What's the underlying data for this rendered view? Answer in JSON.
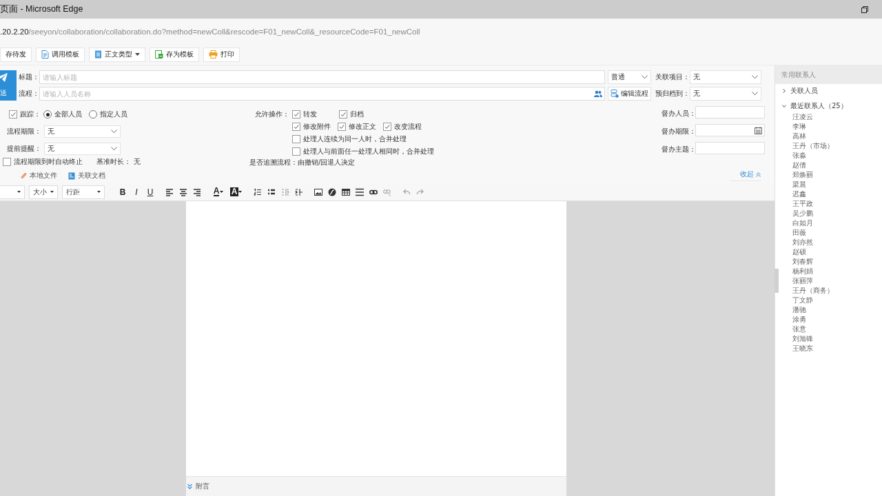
{
  "window": {
    "title": "页面 - Microsoft Edge"
  },
  "address": {
    "host": ".20.2.20",
    "path": "/seeyon/collaboration/collaboration.do?method=newColl&rescode=F01_newColl&_resourceCode=F01_newColl"
  },
  "toolbar": [
    {
      "label": "存待发",
      "has_menu": false
    },
    {
      "label": "调用模板",
      "has_menu": false
    },
    {
      "label": "正文类型",
      "has_menu": true
    },
    {
      "label": "存为模板",
      "has_menu": false
    },
    {
      "label": "打印",
      "has_menu": false
    }
  ],
  "send": {
    "label": "送"
  },
  "subject": {
    "label": "标题：",
    "placeholder": "请输入标题",
    "importance": "普通"
  },
  "flow": {
    "label": "流程：",
    "placeholder": "请输入人员名称",
    "edit_button": "编辑流程"
  },
  "related_project": {
    "label": "关联项目：",
    "value": "无"
  },
  "archive": {
    "label": "预归档到：",
    "value": "无"
  },
  "track": {
    "label": "跟踪：",
    "checked": true,
    "options": [
      {
        "label": "全部人员",
        "selected": true
      },
      {
        "label": "指定人员",
        "selected": false
      }
    ]
  },
  "deadline": {
    "label": "流程期限：",
    "value": "无"
  },
  "reminder": {
    "label": "提前提醒：",
    "value": "无"
  },
  "auto_end": {
    "label": "流程期限到时自动终止",
    "checked": false
  },
  "base_duration": {
    "label": "基准时长：",
    "value": "无"
  },
  "attachments": [
    {
      "label": "本地文件"
    },
    {
      "label": "关联文档"
    }
  ],
  "permissions": {
    "label": "允许操作：",
    "rows": [
      {
        "items": [
          {
            "label": "转发",
            "checked": true
          },
          {
            "label": "归档",
            "checked": true
          }
        ]
      },
      {
        "items": [
          {
            "label": "修改附件",
            "checked": true
          },
          {
            "label": "修改正文",
            "checked": true
          },
          {
            "label": "改变流程",
            "checked": true
          }
        ]
      },
      {
        "items": [
          {
            "label": "处理人连续为同一人时，合并处理",
            "checked": false
          }
        ]
      },
      {
        "items": [
          {
            "label": "处理人与前面任一处理人相同时，合并处理",
            "checked": false
          }
        ]
      }
    ]
  },
  "trace": {
    "label": "是否追溯流程：",
    "value": "由撤销/回退人决定"
  },
  "supervision": [
    {
      "label": "督办人员：",
      "kind": "text"
    },
    {
      "label": "督办期限：",
      "kind": "date"
    },
    {
      "label": "督办主题：",
      "kind": "text"
    }
  ],
  "collapse": "收起",
  "editor_toolbar": {
    "selects": [
      {
        "label": "大小"
      },
      {
        "label": "行距"
      }
    ],
    "format_buttons": [
      {
        "label": "B"
      },
      {
        "label": "I"
      },
      {
        "label": "U"
      }
    ],
    "tool_buttons": [
      {
        "disabled": false
      },
      {
        "disabled": false
      },
      {
        "disabled": false
      },
      {
        "label": "A",
        "disabled": false
      },
      {
        "label": "A",
        "disabled": false
      },
      {
        "disabled": false
      },
      {
        "disabled": false
      },
      {
        "disabled": true
      },
      {
        "disabled": false
      },
      {
        "disabled": false
      },
      {
        "disabled": false
      },
      {
        "disabled": false
      },
      {
        "disabled": false
      },
      {
        "disabled": false
      },
      {
        "disabled": true
      },
      {
        "disabled": true
      },
      {
        "disabled": true
      }
    ]
  },
  "footer": {
    "label": "附言"
  },
  "sidebar": {
    "title": "常用联系人",
    "groups": [
      {
        "label": "关联人员",
        "expanded": false
      },
      {
        "label": "最近联系人（25）",
        "expanded": true,
        "children": [
          {
            "label": "汪凌云"
          },
          {
            "label": "李琳"
          },
          {
            "label": "高林"
          },
          {
            "label": "王丹（市场）"
          },
          {
            "label": "张淼"
          },
          {
            "label": "赵倩"
          },
          {
            "label": "郑焕丽"
          },
          {
            "label": "梁晨"
          },
          {
            "label": "迟鑫"
          },
          {
            "label": "王平政"
          },
          {
            "label": "吴少鹏"
          },
          {
            "label": "白如月"
          },
          {
            "label": "田薇"
          },
          {
            "label": "刘亦然"
          },
          {
            "label": "赵硕"
          },
          {
            "label": "刘春辉"
          },
          {
            "label": "杨利娟"
          },
          {
            "label": "张丽萍"
          },
          {
            "label": "王丹（商务）"
          },
          {
            "label": "丁文静"
          },
          {
            "label": "潘驰"
          },
          {
            "label": "涂勇"
          },
          {
            "label": "张意"
          },
          {
            "label": "刘旭锋"
          },
          {
            "label": "王晓东"
          }
        ]
      }
    ]
  }
}
